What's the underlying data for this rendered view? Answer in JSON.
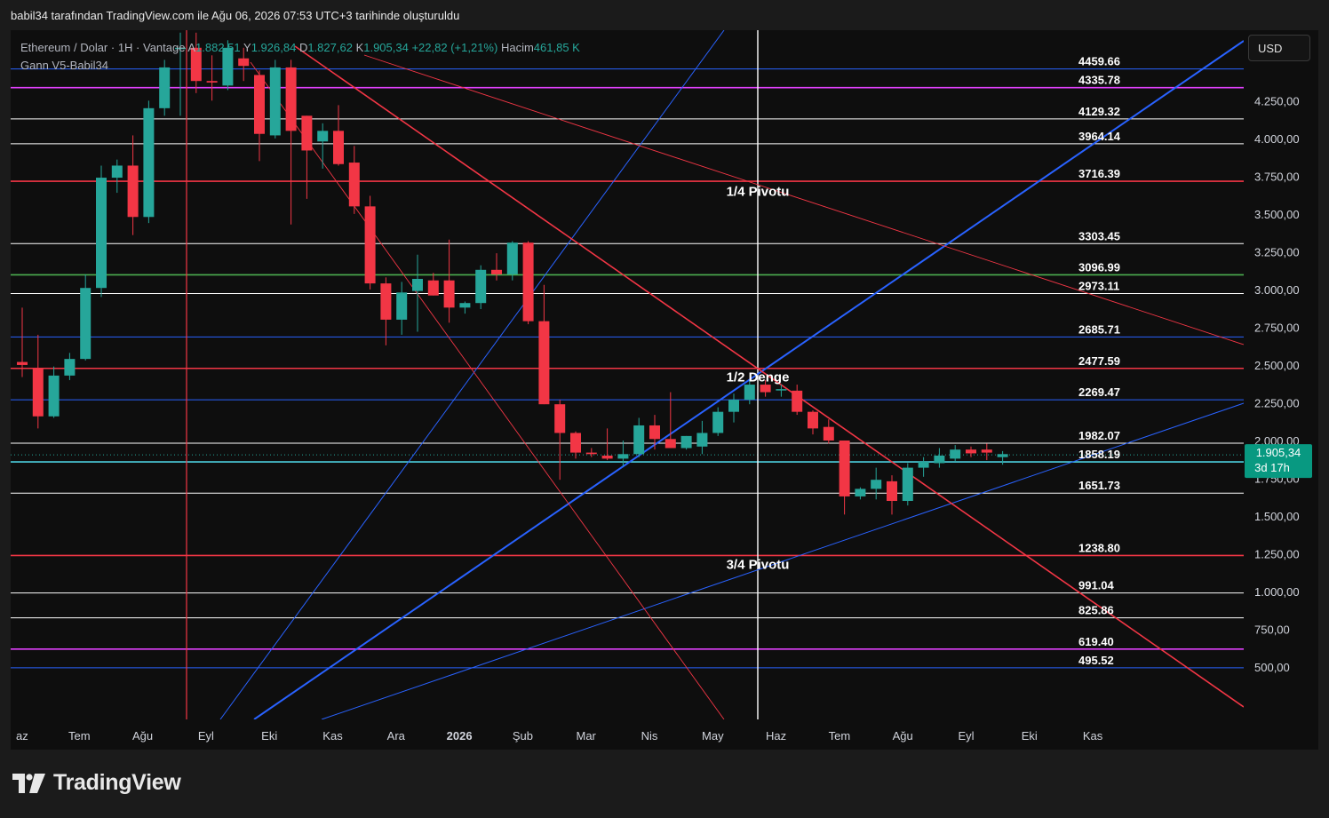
{
  "caption": "babil34 tarafından TradingView.com ile Ağu 06, 2026 07:53 UTC+3 tarihinde oluşturuldu",
  "legend": {
    "symbol": "Ethereum / Dolar · 1H · Vantage",
    "a_label": "A",
    "a_value": "1.882,51",
    "y_label": "Y",
    "y_value": "1.926,84",
    "d_label": "D",
    "d_value": "1.827,62",
    "k_label": "K",
    "k_value": "1.905,34",
    "change": "+22,82 (+1,21%)",
    "volume_label": "Hacim",
    "volume_value": "461,85 K",
    "indicator": "Gann V5-Babil34"
  },
  "currency_button": "USD",
  "brand": "TradingView",
  "colors": {
    "bull": "#26a69a",
    "bear": "#f23645",
    "magenta": "#e040fb",
    "red_line": "#f23645",
    "green_line": "#4caf50",
    "cyan_line": "#4dd0e1",
    "blue_line": "#2962ff",
    "white_line": "#ffffff"
  },
  "chart_data": {
    "type": "candlestick",
    "x_labels": [
      "az",
      "Tem",
      "Ağu",
      "Eyl",
      "Eki",
      "Kas",
      "Ara",
      "2026",
      "Şub",
      "Mar",
      "Nis",
      "May",
      "Haz",
      "Tem",
      "Ağu",
      "Eyl",
      "Eki",
      "Kas"
    ],
    "y_ticks": [
      "4.250,00",
      "4.000,00",
      "3.750,00",
      "3.500,00",
      "3.250,00",
      "3.000,00",
      "2.750,00",
      "2.500,00",
      "2.250,00",
      "2.000,00",
      "1.750,00",
      "1.500,00",
      "1.250,00",
      "1.000,00",
      "750,00",
      "500,00"
    ],
    "y_tick_values": [
      4250,
      4000,
      3750,
      3500,
      3250,
      3000,
      2750,
      2500,
      2250,
      2000,
      1750,
      1500,
      1250,
      1000,
      750,
      500
    ],
    "ylim": [
      330,
      4540
    ],
    "current_price": {
      "label": "1.905,34",
      "countdown": "3d 17h",
      "value": 1905.34
    },
    "levels": [
      {
        "value": 4459.66,
        "label": "4459.66",
        "color": "blue"
      },
      {
        "value": 4335.78,
        "label": "4335.78",
        "color": "magenta"
      },
      {
        "value": 4129.32,
        "label": "4129.32",
        "color": "white"
      },
      {
        "value": 3964.14,
        "label": "3964.14",
        "color": "white"
      },
      {
        "value": 3716.39,
        "label": "3716.39",
        "color": "red"
      },
      {
        "value": 3303.45,
        "label": "3303.45",
        "color": "white"
      },
      {
        "value": 3096.99,
        "label": "3096.99",
        "color": "green"
      },
      {
        "value": 2973.11,
        "label": "2973.11",
        "color": "white"
      },
      {
        "value": 2685.71,
        "label": "2685.71",
        "color": "blue"
      },
      {
        "value": 2477.59,
        "label": "2477.59",
        "color": "red"
      },
      {
        "value": 2269.47,
        "label": "2269.47",
        "color": "blue"
      },
      {
        "value": 1982.07,
        "label": "1982.07",
        "color": "white"
      },
      {
        "value": 1858.19,
        "label": "1858.19",
        "color": "cyan"
      },
      {
        "value": 1651.73,
        "label": "1651.73",
        "color": "white"
      },
      {
        "value": 1238.8,
        "label": "1238.80",
        "color": "red"
      },
      {
        "value": 991.04,
        "label": "991.04",
        "color": "white"
      },
      {
        "value": 825.86,
        "label": "825.86",
        "color": "white"
      },
      {
        "value": 619.4,
        "label": "619.40",
        "color": "magenta"
      },
      {
        "value": 495.52,
        "label": "495.52",
        "color": "blue"
      }
    ],
    "annotations": [
      {
        "text": "1/4 Pivotu",
        "value": 3620
      },
      {
        "text": "1/2 Denge",
        "value": 2390
      },
      {
        "text": "3/4 Pivotu",
        "value": 1150
      }
    ],
    "candles": [
      {
        "o": 2520,
        "h": 2880,
        "l": 2420,
        "c": 2500
      },
      {
        "o": 2480,
        "h": 2700,
        "l": 2080,
        "c": 2160
      },
      {
        "o": 2160,
        "h": 2490,
        "l": 2150,
        "c": 2430
      },
      {
        "o": 2430,
        "h": 2580,
        "l": 2400,
        "c": 2540
      },
      {
        "o": 2540,
        "h": 3100,
        "l": 2530,
        "c": 3010
      },
      {
        "o": 3010,
        "h": 3820,
        "l": 2950,
        "c": 3740
      },
      {
        "o": 3740,
        "h": 3860,
        "l": 3640,
        "c": 3820
      },
      {
        "o": 3820,
        "h": 4020,
        "l": 3360,
        "c": 3480
      },
      {
        "o": 3480,
        "h": 4250,
        "l": 3440,
        "c": 4200
      },
      {
        "o": 4200,
        "h": 4520,
        "l": 4150,
        "c": 4470
      },
      {
        "o": 4600,
        "h": 4700,
        "l": 4150,
        "c": 4600
      },
      {
        "o": 4600,
        "h": 4700,
        "l": 4300,
        "c": 4380
      },
      {
        "o": 4380,
        "h": 4550,
        "l": 4250,
        "c": 4370
      },
      {
        "o": 4350,
        "h": 4650,
        "l": 4320,
        "c": 4600
      },
      {
        "o": 4530,
        "h": 4600,
        "l": 4380,
        "c": 4480
      },
      {
        "o": 4420,
        "h": 4450,
        "l": 3850,
        "c": 4030
      },
      {
        "o": 4020,
        "h": 4520,
        "l": 4000,
        "c": 4470
      },
      {
        "o": 4470,
        "h": 4520,
        "l": 3430,
        "c": 4050
      },
      {
        "o": 4150,
        "h": 4150,
        "l": 3600,
        "c": 3920
      },
      {
        "o": 3980,
        "h": 4100,
        "l": 3800,
        "c": 4050
      },
      {
        "o": 4050,
        "h": 4220,
        "l": 3820,
        "c": 3830
      },
      {
        "o": 3840,
        "h": 3950,
        "l": 3500,
        "c": 3550
      },
      {
        "o": 3550,
        "h": 3620,
        "l": 3000,
        "c": 3040
      },
      {
        "o": 3040,
        "h": 3080,
        "l": 2630,
        "c": 2800
      },
      {
        "o": 2800,
        "h": 3050,
        "l": 2700,
        "c": 2980
      },
      {
        "o": 2990,
        "h": 3230,
        "l": 2720,
        "c": 3070
      },
      {
        "o": 3060,
        "h": 3110,
        "l": 2960,
        "c": 2960
      },
      {
        "o": 3060,
        "h": 3330,
        "l": 2780,
        "c": 2880
      },
      {
        "o": 2880,
        "h": 2920,
        "l": 2840,
        "c": 2910
      },
      {
        "o": 2910,
        "h": 3160,
        "l": 2870,
        "c": 3130
      },
      {
        "o": 3130,
        "h": 3240,
        "l": 3060,
        "c": 3100
      },
      {
        "o": 3100,
        "h": 3320,
        "l": 3060,
        "c": 3310
      },
      {
        "o": 3310,
        "h": 3320,
        "l": 2770,
        "c": 2790
      },
      {
        "o": 2790,
        "h": 3030,
        "l": 2240,
        "c": 2240
      },
      {
        "o": 2240,
        "h": 2270,
        "l": 1740,
        "c": 2050
      },
      {
        "o": 2050,
        "h": 2060,
        "l": 1880,
        "c": 1920
      },
      {
        "o": 1920,
        "h": 1950,
        "l": 1890,
        "c": 1910
      },
      {
        "o": 1900,
        "h": 2080,
        "l": 1870,
        "c": 1880
      },
      {
        "o": 1880,
        "h": 2000,
        "l": 1830,
        "c": 1910
      },
      {
        "o": 1910,
        "h": 2150,
        "l": 1890,
        "c": 2100
      },
      {
        "o": 2100,
        "h": 2170,
        "l": 1940,
        "c": 2010
      },
      {
        "o": 2010,
        "h": 2320,
        "l": 1950,
        "c": 1950
      },
      {
        "o": 1950,
        "h": 2030,
        "l": 1940,
        "c": 2030
      },
      {
        "o": 1960,
        "h": 2130,
        "l": 1910,
        "c": 2050
      },
      {
        "o": 2050,
        "h": 2220,
        "l": 2030,
        "c": 2190
      },
      {
        "o": 2190,
        "h": 2310,
        "l": 2120,
        "c": 2270
      },
      {
        "o": 2270,
        "h": 2400,
        "l": 2240,
        "c": 2370
      },
      {
        "o": 2370,
        "h": 2400,
        "l": 2290,
        "c": 2320
      },
      {
        "o": 2340,
        "h": 2370,
        "l": 2290,
        "c": 2340
      },
      {
        "o": 2330,
        "h": 2370,
        "l": 2170,
        "c": 2190
      },
      {
        "o": 2190,
        "h": 2200,
        "l": 2040,
        "c": 2080
      },
      {
        "o": 2090,
        "h": 2140,
        "l": 1980,
        "c": 2000
      },
      {
        "o": 2000,
        "h": 2000,
        "l": 1510,
        "c": 1630
      },
      {
        "o": 1630,
        "h": 1690,
        "l": 1610,
        "c": 1680
      },
      {
        "o": 1680,
        "h": 1820,
        "l": 1610,
        "c": 1740
      },
      {
        "o": 1730,
        "h": 1770,
        "l": 1510,
        "c": 1600
      },
      {
        "o": 1600,
        "h": 1850,
        "l": 1570,
        "c": 1820
      },
      {
        "o": 1820,
        "h": 1890,
        "l": 1760,
        "c": 1860
      },
      {
        "o": 1850,
        "h": 1950,
        "l": 1820,
        "c": 1900
      },
      {
        "o": 1880,
        "h": 1970,
        "l": 1860,
        "c": 1940
      },
      {
        "o": 1940,
        "h": 1960,
        "l": 1890,
        "c": 1915
      },
      {
        "o": 1940,
        "h": 1980,
        "l": 1870,
        "c": 1920
      },
      {
        "o": 1890,
        "h": 1930,
        "l": 1840,
        "c": 1910
      }
    ]
  }
}
